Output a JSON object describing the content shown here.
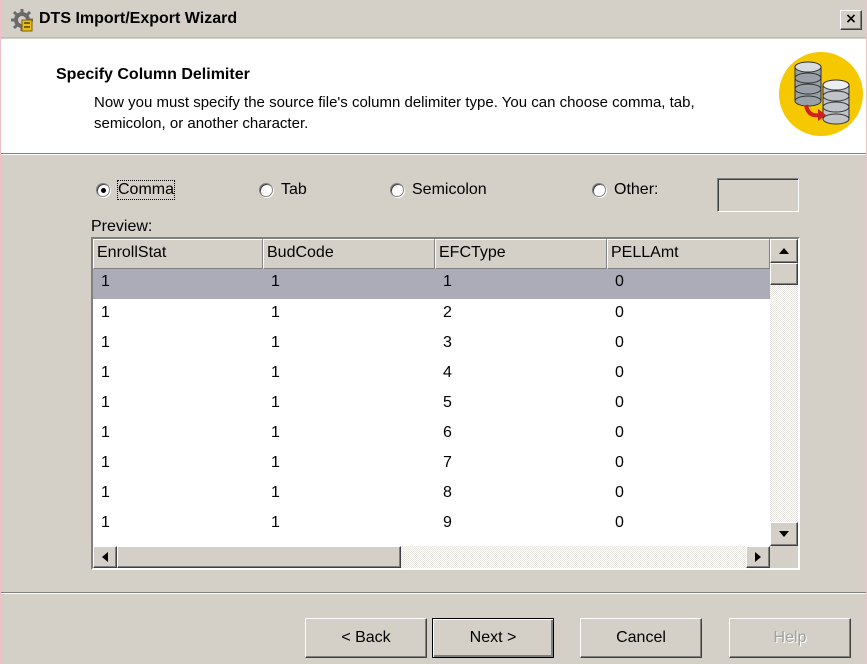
{
  "window": {
    "title": "DTS Import/Export Wizard",
    "close_glyph": "×",
    "icon": "dts-wizard-icon"
  },
  "header": {
    "title": "Specify Column Delimiter",
    "description": "Now you must specify the source file's column delimiter type.  You can choose comma, tab, semicolon, or another character.",
    "icon": "database-transfer-icon"
  },
  "delimiter": {
    "selected": "Comma",
    "options": [
      {
        "label": "Comma",
        "checked": true
      },
      {
        "label": "Tab",
        "checked": false
      },
      {
        "label": "Semicolon",
        "checked": false
      },
      {
        "label": "Other:",
        "checked": false
      }
    ],
    "other_value": ""
  },
  "preview": {
    "label": "Preview:",
    "columns": [
      "EnrollStat",
      "BudCode",
      "EFCType",
      "PELLAmt"
    ],
    "rows": [
      [
        "1",
        "1",
        "1",
        "0"
      ],
      [
        "1",
        "1",
        "2",
        "0"
      ],
      [
        "1",
        "1",
        "3",
        "0"
      ],
      [
        "1",
        "1",
        "4",
        "0"
      ],
      [
        "1",
        "1",
        "5",
        "0"
      ],
      [
        "1",
        "1",
        "6",
        "0"
      ],
      [
        "1",
        "1",
        "7",
        "0"
      ],
      [
        "1",
        "1",
        "8",
        "0"
      ],
      [
        "1",
        "1",
        "9",
        "0"
      ]
    ],
    "selected_row": 0
  },
  "buttons": {
    "back": "< Back",
    "next": "Next >",
    "cancel": "Cancel",
    "help": "Help"
  },
  "colors": {
    "face": "#d4d0c8",
    "header_bg": "#ffffff",
    "selected_row": "#acacb8",
    "disabled_text": "#a0a0a0"
  }
}
